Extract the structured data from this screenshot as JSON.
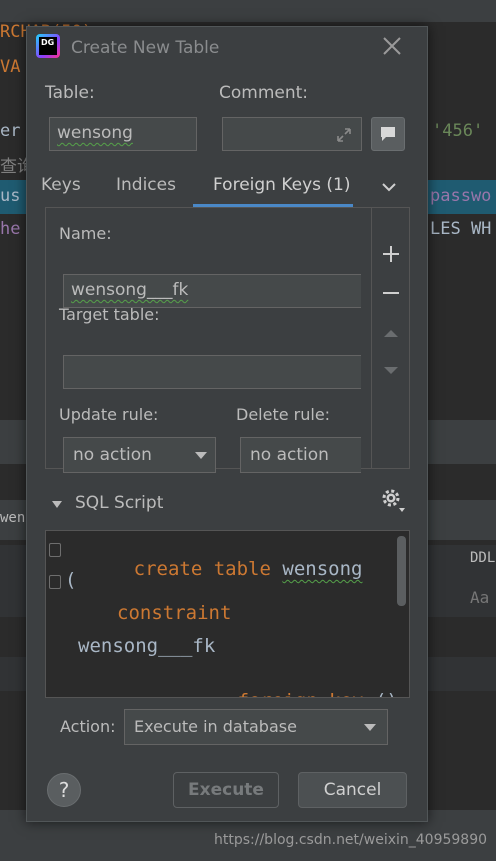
{
  "background": {
    "code_fragments": [
      "RCHAR(50)",
      "VA",
      "er",
      "'456'",
      "查询",
      "us",
      "passwo",
      "he",
      "LES WH",
      "wen",
      "DDL",
      "Aa"
    ]
  },
  "dialog": {
    "title": "Create New Table",
    "table_label": "Table:",
    "table_value": "wensong",
    "comment_label": "Comment:",
    "comment_value": "",
    "tabs": [
      "Keys",
      "Indices",
      "Foreign Keys (1)"
    ],
    "active_tab": "Foreign Keys (1)",
    "fk": {
      "name_label": "Name:",
      "name_value": "wensong___fk",
      "target_label": "Target table:",
      "target_value": "",
      "update_label": "Update rule:",
      "update_value": "no action",
      "delete_label": "Delete rule:",
      "delete_value": "no action"
    },
    "sql_label": "SQL Script",
    "sql": {
      "l1_kw": "create table",
      "l1_name": "wensong",
      "l2": "(",
      "l3_kw": "constraint",
      "l4": "wensong___fk",
      "l5_kw": "foreign key",
      "l5_rest": "()"
    },
    "action_label": "Action:",
    "action_value": "Execute in database",
    "execute_label": "Execute",
    "cancel_label": "Cancel",
    "help_label": "?"
  },
  "watermark": "https://blog.csdn.net/weixin_40959890",
  "colors": {
    "keyword": "#cc7832",
    "accent": "#4a88c7",
    "dialog_bg": "#3c3f41"
  }
}
